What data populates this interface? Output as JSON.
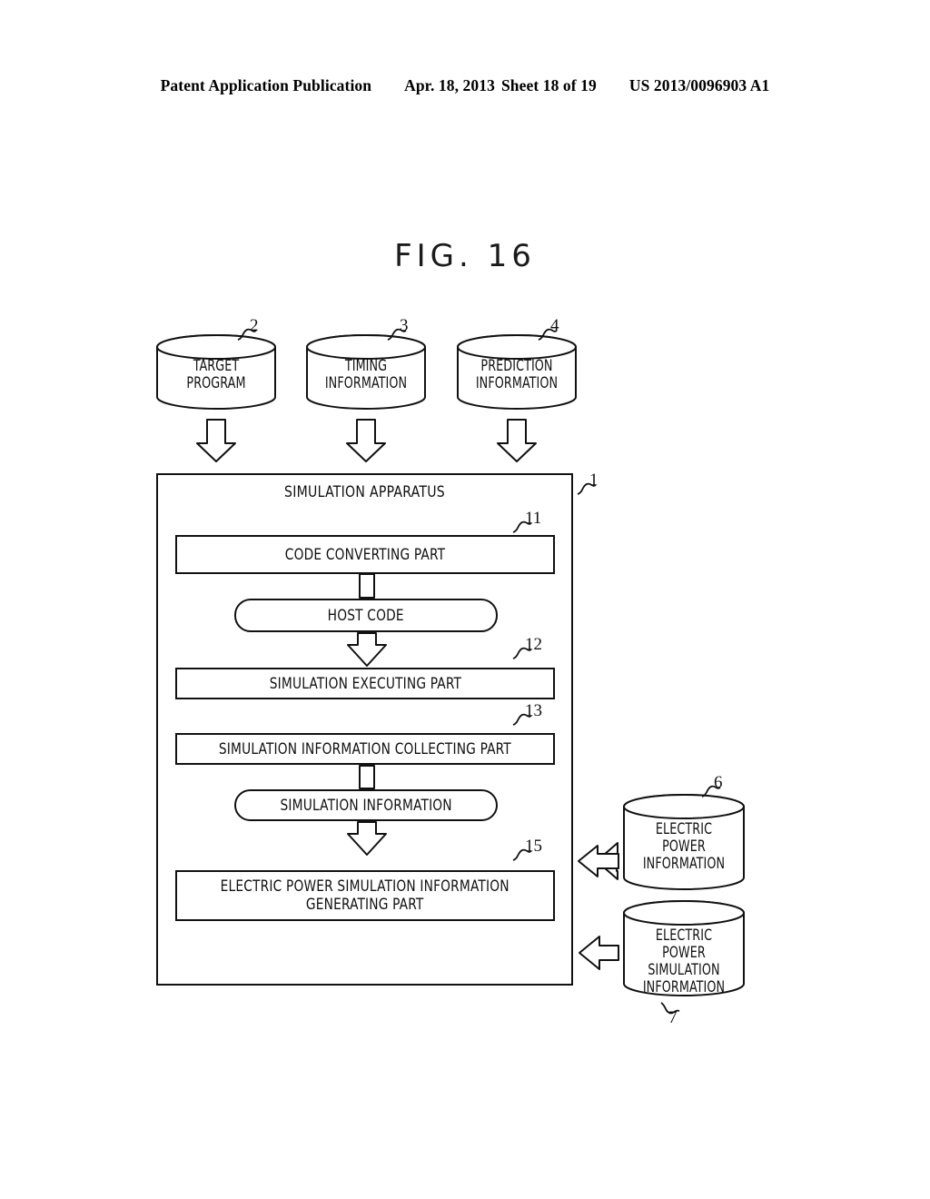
{
  "header": {
    "publication": "Patent Application Publication",
    "date": "Apr. 18, 2013",
    "sheet": "Sheet 18 of 19",
    "docnumber": "US 2013/0096903 A1"
  },
  "figure": {
    "title": "FIG. 16",
    "sources": [
      {
        "id": "target-program",
        "label": "TARGET\nPROGRAM",
        "ref": "2"
      },
      {
        "id": "timing-information",
        "label": "TIMING\nINFORMATION",
        "ref": "3"
      },
      {
        "id": "prediction-information",
        "label": "PREDICTION\nINFORMATION",
        "ref": "4"
      }
    ],
    "apparatus": {
      "label": "SIMULATION APPARATUS",
      "ref": "1",
      "blocks": [
        {
          "id": "code-converting-part",
          "label": "CODE CONVERTING PART",
          "ref": "11",
          "shape": "rect"
        },
        {
          "id": "host-code",
          "label": "HOST CODE",
          "ref": "",
          "shape": "round"
        },
        {
          "id": "simulation-executing-part",
          "label": "SIMULATION EXECUTING PART",
          "ref": "12",
          "shape": "rect"
        },
        {
          "id": "simulation-information-collecting-part",
          "label": "SIMULATION INFORMATION COLLECTING PART",
          "ref": "13",
          "shape": "rect"
        },
        {
          "id": "simulation-information",
          "label": "SIMULATION INFORMATION",
          "ref": "",
          "shape": "round"
        },
        {
          "id": "electric-power-simulation-information-generating-part",
          "label": "ELECTRIC POWER SIMULATION INFORMATION\nGENERATING PART",
          "ref": "15",
          "shape": "rect"
        }
      ]
    },
    "stores": [
      {
        "id": "electric-power-information",
        "label": "ELECTRIC\nPOWER\nINFORMATION",
        "ref": "6",
        "arrow": "left"
      },
      {
        "id": "electric-power-simulation-information",
        "label": "ELECTRIC POWER\nSIMULATION\nINFORMATION",
        "ref": "7",
        "arrow": "right"
      }
    ],
    "colors": {
      "ink": "#111111",
      "paper": "#ffffff"
    }
  }
}
